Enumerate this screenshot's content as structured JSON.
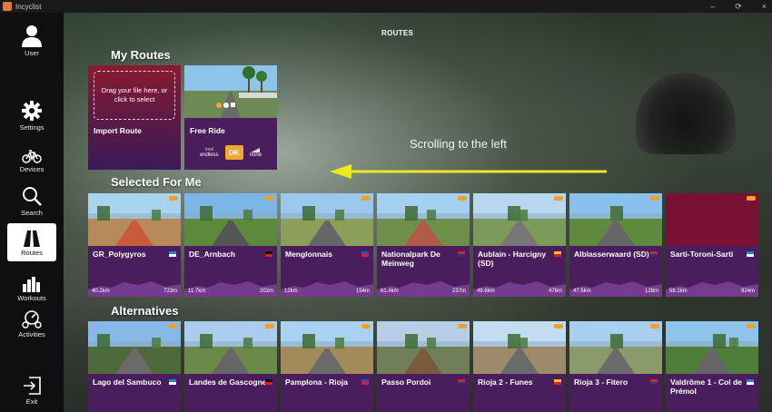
{
  "window": {
    "title": "Incyclist",
    "controls": [
      "–",
      "⟳",
      "×"
    ]
  },
  "header": {
    "title": "ROUTES"
  },
  "sidebar": {
    "items": [
      {
        "label": "User",
        "icon": "user-icon"
      },
      {
        "label": "Settings",
        "icon": "gear-icon"
      },
      {
        "label": "Devices",
        "icon": "bike-icon"
      },
      {
        "label": "Search",
        "icon": "search-icon"
      },
      {
        "label": "Routes",
        "icon": "routes-icon",
        "active": true
      },
      {
        "label": "Workouts",
        "icon": "workouts-icon"
      },
      {
        "label": "Activities",
        "icon": "activities-icon"
      },
      {
        "label": "Exit",
        "icon": "exit-icon"
      }
    ]
  },
  "sections": {
    "my_routes": "My Routes",
    "selected": "Selected For Me",
    "alternatives": "Alternatives"
  },
  "import_card": {
    "drop_text": "Drag your file here, or click to select",
    "label": "Import Route"
  },
  "free_ride": {
    "label": "Free Ride",
    "left_small": "total",
    "left_value": "endless",
    "ok": "OK",
    "right_value": "none"
  },
  "annotation": {
    "text": "Scrolling to the left"
  },
  "selected_routes": [
    {
      "name": "GR_Polygyros",
      "dist": "40.2km",
      "elev": "723m"
    },
    {
      "name": "DE_Arnbach",
      "dist": "11.7km",
      "elev": "202m"
    },
    {
      "name": "Menglonnais",
      "dist": "12km",
      "elev": "154m"
    },
    {
      "name": "Nationalpark De Meinweg",
      "dist": "61.4km",
      "elev": "237m"
    },
    {
      "name": "Aublain - Harcigny (SD)",
      "dist": "49.6km",
      "elev": "476m"
    },
    {
      "name": "Alblasserwaard (SD)",
      "dist": "47.5km",
      "elev": "128m"
    },
    {
      "name": "Sarti-Toroni-Sarti",
      "dist": "58.1km",
      "elev": "924m"
    }
  ],
  "alternative_routes": [
    {
      "name": "Lago del Sambuco"
    },
    {
      "name": "Landes de Gascogne"
    },
    {
      "name": "Pamplona - Rioja"
    },
    {
      "name": "Passo Pordoi"
    },
    {
      "name": "Rioja 2 - Funes"
    },
    {
      "name": "Rioja 3 - Fitero"
    },
    {
      "name": "Valdrôme 1 - Col de Prémol"
    }
  ],
  "colors": {
    "card": "#4a1e5c",
    "accent": "#f2a72e",
    "arrow": "#f0e81e"
  }
}
